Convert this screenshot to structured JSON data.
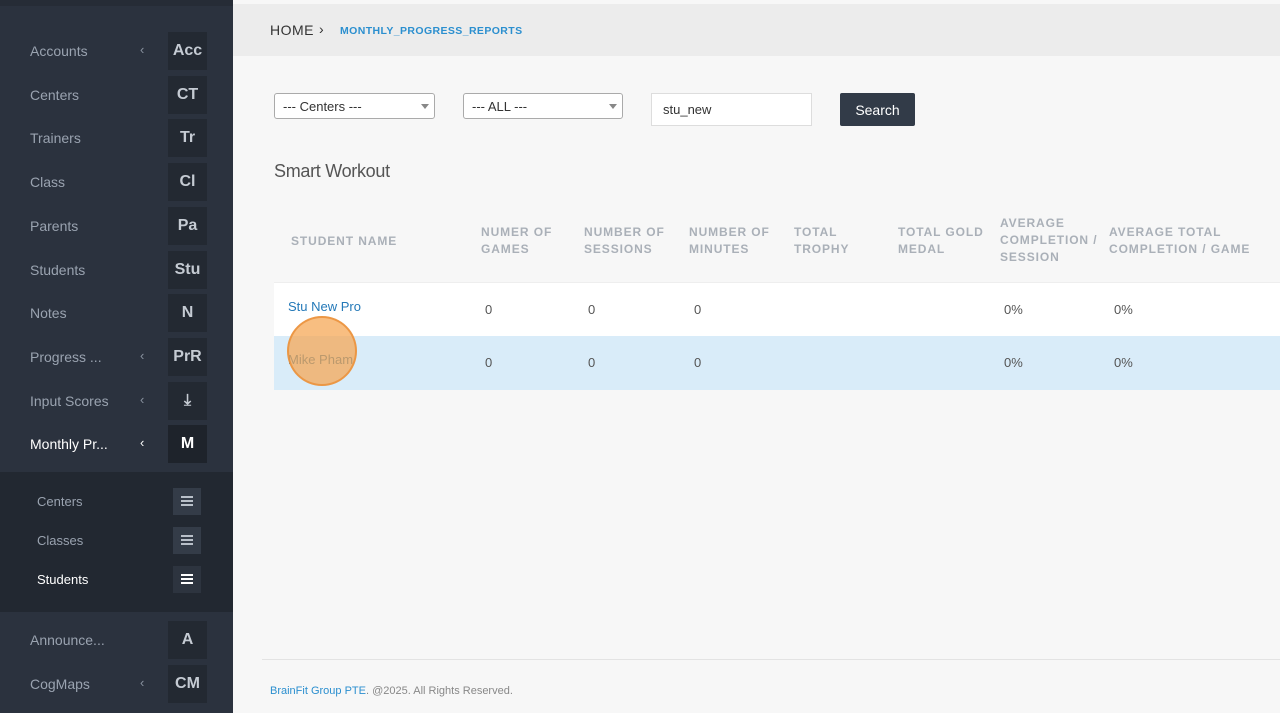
{
  "sidebar": {
    "items": [
      {
        "label": "Accounts",
        "badge": "Acc",
        "chevron": "‹"
      },
      {
        "label": "Centers",
        "badge": "CT",
        "chevron": ""
      },
      {
        "label": "Trainers",
        "badge": "Tr",
        "chevron": ""
      },
      {
        "label": "Class",
        "badge": "Cl",
        "chevron": ""
      },
      {
        "label": "Parents",
        "badge": "Pa",
        "chevron": ""
      },
      {
        "label": "Students",
        "badge": "Stu",
        "chevron": ""
      },
      {
        "label": "Notes",
        "badge": "N",
        "chevron": ""
      },
      {
        "label": "Progress ...",
        "badge": "PrR",
        "chevron": "‹"
      },
      {
        "label": "Input Scores",
        "badge": "⤓",
        "chevron": "‹"
      },
      {
        "label": "Monthly Pr...",
        "badge": "M",
        "chevron": "‹"
      },
      {
        "label": "Announce...",
        "badge": "A",
        "chevron": ""
      },
      {
        "label": "CogMaps",
        "badge": "CM",
        "chevron": "‹"
      }
    ],
    "submenu": [
      {
        "label": "Centers"
      },
      {
        "label": "Classes"
      },
      {
        "label": "Students"
      }
    ]
  },
  "header": {
    "home": "HOME",
    "separator": "›",
    "current": "MONTHLY_PROGRESS_REPORTS"
  },
  "filters": {
    "centers_selected": "--- Centers ---",
    "all_selected": "--- ALL ---",
    "search_value": "stu_new",
    "search_button": "Search"
  },
  "section_title": "Smart Workout",
  "table": {
    "columns": [
      "STUDENT NAME",
      "NUMER OF GAMES",
      "NUMBER OF SESSIONS",
      "NUMBER OF MINUTES",
      "TOTAL TROPHY",
      "TOTAL GOLD MEDAL",
      "AVERAGE COMPLETION / SESSION",
      "AVERAGE TOTAL COMPLETION / GAME"
    ],
    "rows": [
      {
        "name": "Stu New Pro",
        "games": "0",
        "sessions": "0",
        "minutes": "0",
        "trophy": "",
        "gold": "",
        "avg_session": "0%",
        "avg_game": "0%"
      },
      {
        "name": "Mike Pham",
        "games": "0",
        "sessions": "0",
        "minutes": "0",
        "trophy": "",
        "gold": "",
        "avg_session": "0%",
        "avg_game": "0%"
      }
    ]
  },
  "footer": {
    "company": "BrainFit Group PTE",
    "rights": ". @2025. All Rights Reserved."
  }
}
